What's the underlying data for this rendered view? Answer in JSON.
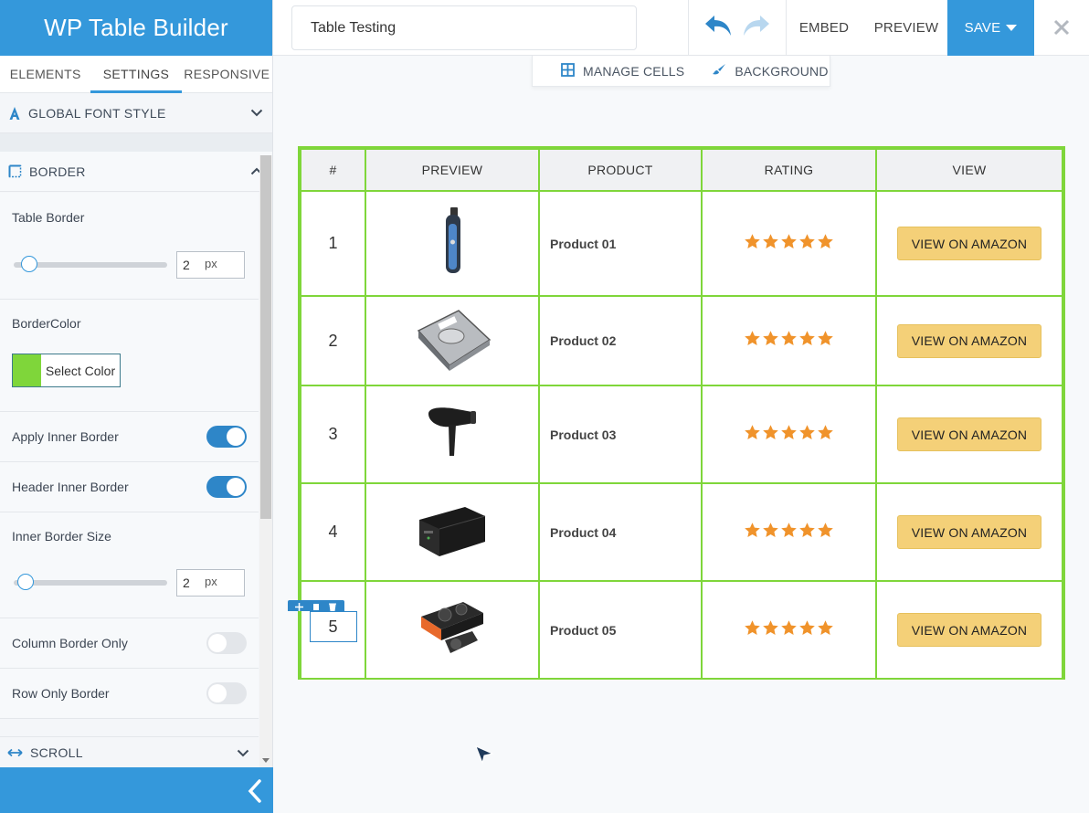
{
  "sidebar": {
    "brand": "WP Table Builder",
    "tabs": [
      {
        "label": "ELEMENTS"
      },
      {
        "label": "SETTINGS"
      },
      {
        "label": "RESPONSIVE"
      }
    ],
    "active_tab": "SETTINGS",
    "global_font_style": "GLOBAL FONT STYLE",
    "border": {
      "title": "BORDER",
      "table_border_label": "Table Border",
      "table_border_value": "2",
      "unit": "px",
      "border_color_label": "BorderColor",
      "border_color": "#7fd63a",
      "select_color_label": "Select Color",
      "apply_inner_border_label": "Apply Inner Border",
      "apply_inner_border": true,
      "header_inner_border_label": "Header Inner Border",
      "header_inner_border": true,
      "inner_border_size_label": "Inner Border Size",
      "inner_border_size_value": "2",
      "column_border_only_label": "Column Border Only",
      "column_border_only": false,
      "row_only_border_label": "Row Only Border",
      "row_only_border": false
    },
    "scroll_label": "SCROLL"
  },
  "topbar": {
    "table_title": "Table Testing",
    "embed_label": "EMBED",
    "preview_label": "PREVIEW",
    "save_label": "SAVE"
  },
  "toolbar": {
    "manage_cells_label": "MANAGE CELLS",
    "background_label": "BACKGROUND"
  },
  "table": {
    "headers": [
      "#",
      "PREVIEW",
      "PRODUCT",
      "RATING",
      "VIEW"
    ],
    "rows": [
      {
        "num": "1",
        "product": "Product 01",
        "rating": 5,
        "button": "VIEW ON AMAZON",
        "image": "trimmer"
      },
      {
        "num": "2",
        "product": "Product 02",
        "rating": 5,
        "button": "VIEW ON AMAZON",
        "image": "hard-drive"
      },
      {
        "num": "3",
        "product": "Product 03",
        "rating": 5,
        "button": "VIEW ON AMAZON",
        "image": "hair-dryer"
      },
      {
        "num": "4",
        "product": "Product 04",
        "rating": 5,
        "button": "VIEW ON AMAZON",
        "image": "ups"
      },
      {
        "num": "5",
        "product": "Product 05",
        "rating": 5,
        "button": "VIEW ON AMAZON",
        "image": "graphics-card"
      }
    ],
    "star_color": "#f0932b",
    "border_color": "#7fd63a"
  }
}
